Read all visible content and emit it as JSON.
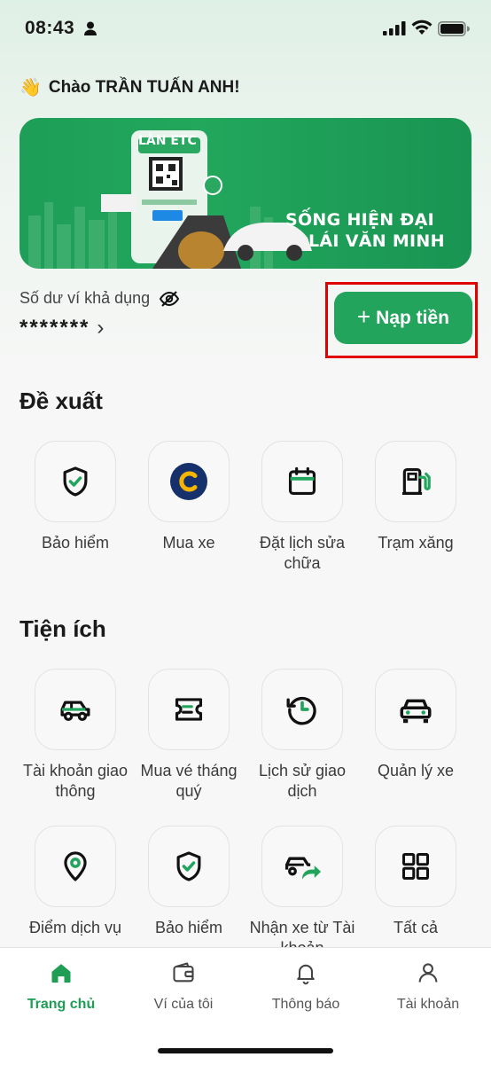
{
  "status_bar": {
    "time": "08:43"
  },
  "greeting": {
    "emoji": "👋",
    "text": "Chào TRẦN TUẤN ANH!"
  },
  "banner": {
    "brand": "LÀN ETC",
    "line1": "SỐNG HIỆN ĐẠI",
    "line2": "LÁI VĂN MINH"
  },
  "wallet": {
    "balance_label": "Số dư ví khả dụng",
    "balance_masked": "*******",
    "topup_label": "Nạp tiền"
  },
  "suggested": {
    "title": "Đề xuất",
    "items": [
      {
        "label": "Bảo hiểm",
        "icon": "shield-check-icon"
      },
      {
        "label": "Mua xe",
        "icon": "c-logo-icon"
      },
      {
        "label": "Đặt lịch sửa chữa",
        "icon": "calendar-icon"
      },
      {
        "label": "Trạm xăng",
        "icon": "fuel-pump-icon"
      }
    ]
  },
  "utilities": {
    "title": "Tiện ích",
    "items": [
      {
        "label": "Tài khoản giao thông",
        "icon": "car-icon"
      },
      {
        "label": "Mua vé tháng quý",
        "icon": "ticket-icon"
      },
      {
        "label": "Lịch sử giao dịch",
        "icon": "history-clock-icon"
      },
      {
        "label": "Quản lý xe",
        "icon": "car-front-icon"
      },
      {
        "label": "Điểm dịch vụ",
        "icon": "location-pin-icon"
      },
      {
        "label": "Bảo hiểm",
        "icon": "shield-check-icon"
      },
      {
        "label": "Nhận xe từ Tài khoản",
        "icon": "car-share-icon"
      },
      {
        "label": "Tất cả",
        "icon": "grid-icon"
      }
    ]
  },
  "tabbar": {
    "items": [
      {
        "label": "Trang chủ",
        "icon": "home-icon",
        "active": true
      },
      {
        "label": "Ví của tôi",
        "icon": "wallet-icon"
      },
      {
        "label": "Thông báo",
        "icon": "bell-icon"
      },
      {
        "label": "Tài khoản",
        "icon": "user-icon"
      }
    ]
  },
  "colors": {
    "primary": "#22a45d",
    "highlight": "#e00000",
    "text": "#1a1a1a"
  }
}
